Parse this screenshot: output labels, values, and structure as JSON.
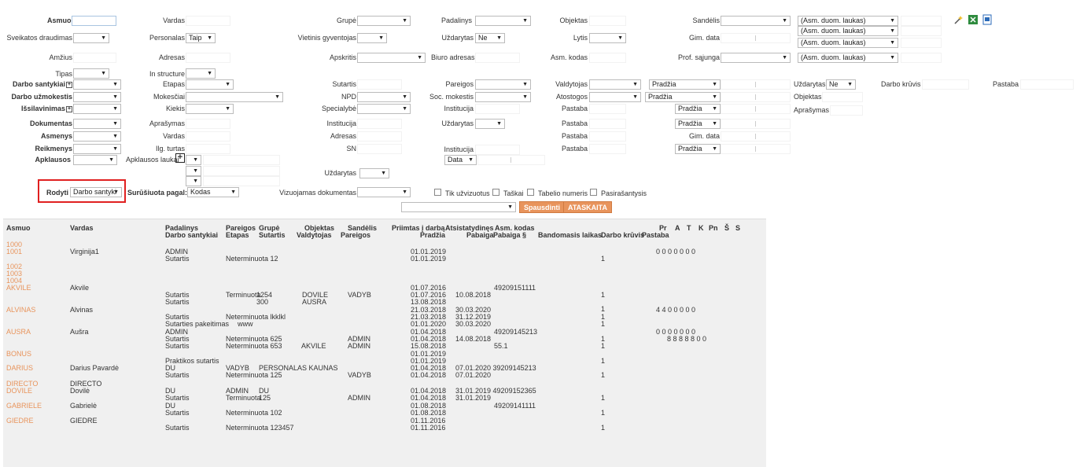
{
  "filters": {
    "asmuo": "Asmuo",
    "vardas": "Vardas",
    "grupe": "Grupė",
    "padalinys": "Padalinys",
    "objektas": "Objektas",
    "sandelis": "Sandėlis",
    "asm_duom_1": "(Asm. duom. laukas)",
    "asm_duom_2": "(Asm. duom. laukas)",
    "asm_duom_3": "(Asm. duom. laukas)",
    "asm_duom_4": "(Asm. duom. laukas)",
    "sveikatos": "Sveikatos draudimas",
    "personalas": "Personalas",
    "personalas_val": "Taip",
    "vietinis": "Vietinis gyventojas",
    "uzdarytas": "Uždarytas",
    "uzdarytas_val": "Ne",
    "lytis": "Lytis",
    "gim_data": "Gim. data",
    "amzius": "Amžius",
    "adresas": "Adresas",
    "apskritis": "Apskritis",
    "biuro_adresas": "Biuro adresas",
    "asm_kodas": "Asm. kodas",
    "prof_sajunga": "Prof. sąjunga",
    "tipas": "Tipas",
    "in_structure": "In structure",
    "darbo_sant": "Darbo santykiai",
    "etapas": "Etapas",
    "sutartis": "Sutartis",
    "pareigos": "Pareigos",
    "valdytojas": "Valdytojas",
    "pradzia": "Pradžia",
    "uzdarytas2": "Uždarytas",
    "uzdarytas2_val": "Ne",
    "darbo_kruvis": "Darbo krūvis",
    "pastaba": "Pastaba",
    "darbo_uzm": "Darbo užmokestis",
    "mokesciai": "Mokesčiai",
    "npd": "NPD",
    "soc_mokestis": "Soc. mokestis",
    "atostogos": "Atostogos",
    "objektas2": "Objektas",
    "issilavinimas": "Išsilavinimas",
    "kiekis": "Kiekis",
    "specialybe": "Specialybė",
    "institucija": "Institucija",
    "pastaba2": "Pastaba",
    "aprasymas": "Aprašymas",
    "dokumentas": "Dokumentas",
    "aprasymas2": "Aprašymas",
    "institucija2": "Institucija",
    "uzdarytas3": "Uždarytas",
    "pastaba3": "Pastaba",
    "asmenys": "Asmenys",
    "vardas2": "Vardas",
    "adresas2": "Adresas",
    "pastaba4": "Pastaba",
    "gim_data2": "Gim. data",
    "reikmenys": "Reikmenys",
    "ilg_turtas": "Ilg. turtas",
    "sn": "SN",
    "institucija3": "Institucija",
    "pastaba5": "Pastaba",
    "apklausos": "Apklausos",
    "apklausos_laukai": "Apklausos laukai",
    "data": "Data",
    "uzdarytas4": "Uždarytas",
    "rodyti": "Rodyti",
    "rodyti_val": "Darbo santyki",
    "surusiuota": "Surūšiuota pagal:",
    "surusiuota_val": "Kodas",
    "vizuojamas": "Vizuojamas dokumentas",
    "tik_uzvizuotus": "Tik užvizuotus",
    "taskai": "Taškai",
    "tabelio_nr": "Tabelio numeris",
    "pasirasantysis": "Pasirašantysis",
    "spausdinti": "Spausdinti",
    "ataskaita": "ATASKAITA"
  },
  "table": {
    "headers": {
      "asmuo": "Asmuo",
      "vardas": "Vardas",
      "padalinys": "Padalinys",
      "darbo_sant": "Darbo santykiai",
      "pareigos": "Pareigos",
      "etapas": "Etapas",
      "grupe": "Grupė",
      "sutartis": "Sutartis",
      "objektas": "Objektas",
      "valdytojas": "Valdytojas",
      "sandelis": "Sandėlis",
      "pareigos2": "Pareigos",
      "priimtas": "Priimtas į darbą",
      "pradzia": "Pradžia",
      "atsistatydines": "Atsistatydinęs",
      "pabaiga": "Pabaiga",
      "asm_kodas": "Asm. kodas",
      "pabaiga2": "Pabaiga §",
      "bandomasis": "Bandomasis laikas",
      "darbo_kruvis": "Darbo krūvis",
      "pastaba": "Pastaba",
      "pr": "Pr",
      "a": "A",
      "t": "T",
      "k": "K",
      "pn": "Pn",
      "s1": "Š",
      "s2": "S"
    },
    "cells": [
      {
        "t": "1000",
        "lnk": true
      },
      {
        "t": "1001",
        "lnk": true
      },
      {
        "t": "Virginija1"
      },
      {
        "t": "ADMIN"
      },
      {
        "t": "01.01.2019"
      },
      {
        "t": "Sutartis"
      },
      {
        "t": "Neterminuota 12"
      },
      {
        "t": "01.01.2019"
      },
      {
        "t": "1"
      },
      {
        "t": "0  0  0  0  0  0  0"
      },
      {
        "t": "1002",
        "lnk": true
      },
      {
        "t": "1003",
        "lnk": true
      },
      {
        "t": "1004",
        "lnk": true
      },
      {
        "t": "AKVILE",
        "lnk": true
      },
      {
        "t": "Akvile"
      },
      {
        "t": "01.07.2016"
      },
      {
        "t": "49209151111"
      },
      {
        "t": "Sutartis"
      },
      {
        "t": "Terminuota"
      },
      {
        "t": "1254"
      },
      {
        "t": "DOVILE"
      },
      {
        "t": "VADYB"
      },
      {
        "t": "01.07.2016"
      },
      {
        "t": "10.08.2018"
      },
      {
        "t": "1"
      },
      {
        "t": "Sutartis"
      },
      {
        "t": "300"
      },
      {
        "t": "AUSRA"
      },
      {
        "t": "13.08.2018"
      },
      {
        "t": "1"
      },
      {
        "t": "ALVINAS",
        "lnk": true
      },
      {
        "t": "Alvinas"
      },
      {
        "t": "21.03.2018"
      },
      {
        "t": "30.03.2020"
      },
      {
        "t": "4  4  0  0  0  0  0"
      },
      {
        "t": "Sutartis"
      },
      {
        "t": "Neterminuota lkklkl"
      },
      {
        "t": "21.03.2018"
      },
      {
        "t": "31.12.2019"
      },
      {
        "t": "1"
      },
      {
        "t": "Sutarties pakeitimas"
      },
      {
        "t": "www"
      },
      {
        "t": "01.01.2020"
      },
      {
        "t": "30.03.2020"
      },
      {
        "t": "1"
      },
      {
        "t": "AUSRA",
        "lnk": true
      },
      {
        "t": "Aušra"
      },
      {
        "t": "ADMIN"
      },
      {
        "t": "01.04.2018"
      },
      {
        "t": "49209145213"
      },
      {
        "t": "0  0  0  0  0  0  0"
      },
      {
        "t": "Sutartis"
      },
      {
        "t": "Neterminuota 625"
      },
      {
        "t": "ADMIN"
      },
      {
        "t": "01.04.2018"
      },
      {
        "t": "14.08.2018"
      },
      {
        "t": "1"
      },
      {
        "t": "8  8  8  8  8  0  0"
      },
      {
        "t": "Sutartis"
      },
      {
        "t": "Neterminuota 653"
      },
      {
        "t": "AKVILE"
      },
      {
        "t": "ADMIN"
      },
      {
        "t": "15.08.2018"
      },
      {
        "t": "55.1"
      },
      {
        "t": "1"
      },
      {
        "t": "BONUS",
        "lnk": true
      },
      {
        "t": "01.01.2019"
      },
      {
        "t": "Praktikos sutartis"
      },
      {
        "t": "01.01.2019"
      },
      {
        "t": "1"
      },
      {
        "t": "DARIUS",
        "lnk": true
      },
      {
        "t": "Darius Pavardė"
      },
      {
        "t": "DU"
      },
      {
        "t": "VADYB"
      },
      {
        "t": "PERSONALAS KAUNAS"
      },
      {
        "t": "01.04.2018"
      },
      {
        "t": "07.01.2020 39209145213"
      },
      {
        "t": "Sutartis"
      },
      {
        "t": "Neterminuota 125"
      },
      {
        "t": "VADYB"
      },
      {
        "t": "01.04.2018"
      },
      {
        "t": "07.01.2020"
      },
      {
        "t": "1"
      },
      {
        "t": "DIRECTO",
        "lnk": true
      },
      {
        "t": "DIRECTO"
      },
      {
        "t": "DOVILE",
        "lnk": true
      },
      {
        "t": "Dovilė"
      },
      {
        "t": "DU"
      },
      {
        "t": "ADMIN"
      },
      {
        "t": "DU"
      },
      {
        "t": "01.04.2018"
      },
      {
        "t": "31.01.2019 49209152365"
      },
      {
        "t": "Sutartis"
      },
      {
        "t": "Terminuota"
      },
      {
        "t": "125"
      },
      {
        "t": "ADMIN"
      },
      {
        "t": "01.04.2018"
      },
      {
        "t": "31.01.2019"
      },
      {
        "t": "1"
      },
      {
        "t": "GABRIELE",
        "lnk": true
      },
      {
        "t": "Gabrielė"
      },
      {
        "t": "DU"
      },
      {
        "t": "01.08.2018"
      },
      {
        "t": "49209141111"
      },
      {
        "t": "Sutartis"
      },
      {
        "t": "Neterminuota 102"
      },
      {
        "t": "01.08.2018"
      },
      {
        "t": "1"
      },
      {
        "t": "GIEDRE",
        "lnk": true
      },
      {
        "t": "GIEDRE"
      },
      {
        "t": "01.11.2016"
      },
      {
        "t": "Sutartis"
      },
      {
        "t": "Neterminuota 123457"
      },
      {
        "t": "01.11.2016"
      },
      {
        "t": "1"
      }
    ]
  }
}
